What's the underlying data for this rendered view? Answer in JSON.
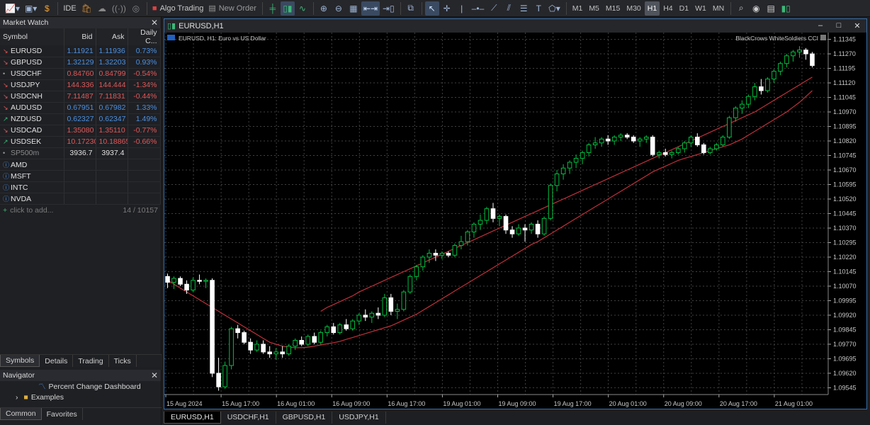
{
  "toolbar": {
    "algo_trading": "Algo Trading",
    "new_order": "New Order",
    "ide": "IDE",
    "timeframes": [
      "M1",
      "M5",
      "M15",
      "M30",
      "H1",
      "H4",
      "D1",
      "W1",
      "MN"
    ],
    "active_timeframe": "H1"
  },
  "market_watch": {
    "title": "Market Watch",
    "columns": [
      "Symbol",
      "Bid",
      "Ask",
      "Daily C..."
    ],
    "rows": [
      {
        "symbol": "EURUSD",
        "bid": "1.11921",
        "ask": "1.11936",
        "change": "0.73%",
        "trend": "dn",
        "color": "up"
      },
      {
        "symbol": "GBPUSD",
        "bid": "1.32129",
        "ask": "1.32203",
        "change": "0.93%",
        "trend": "dn",
        "color": "up"
      },
      {
        "symbol": "USDCHF",
        "bid": "0.84760",
        "ask": "0.84799",
        "change": "-0.54%",
        "trend": "gr",
        "color": "dn"
      },
      {
        "symbol": "USDJPY",
        "bid": "144.336",
        "ask": "144.444",
        "change": "-1.34%",
        "trend": "dn",
        "color": "dn"
      },
      {
        "symbol": "USDCNH",
        "bid": "7.11487",
        "ask": "7.11831",
        "change": "-0.44%",
        "trend": "dn",
        "color": "dn"
      },
      {
        "symbol": "AUDUSD",
        "bid": "0.67951",
        "ask": "0.67982",
        "change": "1.33%",
        "trend": "dn",
        "color": "up"
      },
      {
        "symbol": "NZDUSD",
        "bid": "0.62327",
        "ask": "0.62347",
        "change": "1.49%",
        "trend": "up",
        "color": "up"
      },
      {
        "symbol": "USDCAD",
        "bid": "1.35080",
        "ask": "1.35110",
        "change": "-0.77%",
        "trend": "dn",
        "color": "dn"
      },
      {
        "symbol": "USDSEK",
        "bid": "10.17230",
        "ask": "10.18865",
        "change": "-0.66%",
        "trend": "up",
        "color": "dn"
      },
      {
        "symbol": "SP500m",
        "bid": "3936.7",
        "ask": "3937.4",
        "change": "",
        "trend": "gr",
        "color": "wh"
      },
      {
        "symbol": "AMD",
        "bid": "",
        "ask": "",
        "change": "",
        "trend": "info",
        "color": "wh"
      },
      {
        "symbol": "MSFT",
        "bid": "",
        "ask": "",
        "change": "",
        "trend": "info",
        "color": "wh"
      },
      {
        "symbol": "INTC",
        "bid": "",
        "ask": "",
        "change": "",
        "trend": "info",
        "color": "wh"
      },
      {
        "symbol": "NVDA",
        "bid": "",
        "ask": "",
        "change": "",
        "trend": "info",
        "color": "wh"
      }
    ],
    "add_label": "click to add...",
    "count": "14 / 10157",
    "tabs": [
      "Symbols",
      "Details",
      "Trading",
      "Ticks"
    ],
    "active_tab": "Symbols"
  },
  "navigator": {
    "title": "Navigator",
    "items": [
      "Percent Change Dashboard",
      "Examples"
    ],
    "tabs": [
      "Common",
      "Favorites"
    ],
    "active_tab": "Common"
  },
  "chart_window": {
    "title": "EURUSD,H1",
    "info": "EURUSD, H1:  Euro vs US Dollar",
    "indicator": "BlackCrows WhiteSoldiers CCI"
  },
  "chart_data": {
    "type": "candlestick",
    "symbol": "EURUSD",
    "timeframe": "H1",
    "y_ticks": [
      1.11345,
      1.1127,
      1.11195,
      1.1112,
      1.11045,
      1.1097,
      1.10895,
      1.1082,
      1.10745,
      1.1067,
      1.10595,
      1.1052,
      1.10445,
      1.1037,
      1.10295,
      1.1022,
      1.10145,
      1.1007,
      1.09995,
      1.0992,
      1.09845,
      1.0977,
      1.09695,
      1.0962,
      1.09545
    ],
    "y_tick_labels": [
      "1.11345",
      "1.11270",
      "1.11195",
      "1.11120",
      "1.11045",
      "1.10970",
      "1.10895",
      "1.10820",
      "1.10745",
      "1.10670",
      "1.10595",
      "1.10520",
      "1.10445",
      "1.10370",
      "1.10295",
      "1.10220",
      "1.10145",
      "1.10070",
      "1.09995",
      "1.09920",
      "1.09845",
      "1.09770",
      "1.09695",
      "1.09620",
      "1.09545"
    ],
    "ylim": [
      1.0951,
      1.1138
    ],
    "x_labels": [
      "15 Aug 2024",
      "15 Aug 17:00",
      "16 Aug 01:00",
      "16 Aug 09:00",
      "16 Aug 17:00",
      "19 Aug 01:00",
      "19 Aug 09:00",
      "19 Aug 17:00",
      "20 Aug 01:00",
      "20 Aug 09:00",
      "20 Aug 17:00",
      "21 Aug 01:00"
    ],
    "grid": true,
    "candles": [
      [
        1.1012,
        1.10135,
        1.1006,
        1.1009
      ],
      [
        1.1009,
        1.1012,
        1.10055,
        1.1011
      ],
      [
        1.1011,
        1.1012,
        1.1007,
        1.1008
      ],
      [
        1.1008,
        1.101,
        1.1003,
        1.1005
      ],
      [
        1.1005,
        1.10115,
        1.1004,
        1.101
      ],
      [
        1.101,
        1.1013,
        1.1008,
        1.10095
      ],
      [
        1.10095,
        1.1011,
        1.1006,
        1.101
      ],
      [
        1.101,
        1.1011,
        1.096,
        1.0962
      ],
      [
        1.0962,
        1.097,
        1.0953,
        1.0955
      ],
      [
        1.0955,
        1.0968,
        1.0954,
        1.0966
      ],
      [
        1.0966,
        1.0986,
        1.0964,
        1.0985
      ],
      [
        1.0985,
        1.0987,
        1.098,
        1.0983
      ],
      [
        1.0983,
        1.0984,
        1.0977,
        1.0978
      ],
      [
        1.0978,
        1.098,
        1.0972,
        1.0974
      ],
      [
        1.0974,
        1.0979,
        1.0973,
        1.0977
      ],
      [
        1.0977,
        1.0979,
        1.0972,
        1.0973
      ],
      [
        1.0973,
        1.0976,
        1.097,
        1.0972
      ],
      [
        1.0972,
        1.0975,
        1.0969,
        1.0973
      ],
      [
        1.0973,
        1.0976,
        1.097,
        1.0972
      ],
      [
        1.0972,
        1.0977,
        1.0971,
        1.0976
      ],
      [
        1.0976,
        1.098,
        1.0974,
        1.0979
      ],
      [
        1.0979,
        1.0981,
        1.0976,
        1.0977
      ],
      [
        1.0977,
        1.0982,
        1.0976,
        1.0981
      ],
      [
        1.0981,
        1.0983,
        1.0977,
        1.0978
      ],
      [
        1.0978,
        1.0984,
        1.0977,
        1.0983
      ],
      [
        1.0983,
        1.0987,
        1.0981,
        1.0986
      ],
      [
        1.0986,
        1.0988,
        1.0982,
        1.0983
      ],
      [
        1.0983,
        1.0988,
        1.0982,
        1.0987
      ],
      [
        1.0987,
        1.099,
        1.0984,
        1.0985
      ],
      [
        1.0985,
        1.099,
        1.0984,
        1.0989
      ],
      [
        1.0989,
        1.0993,
        1.0987,
        1.0992
      ],
      [
        1.0992,
        1.0995,
        1.0989,
        1.0991
      ],
      [
        1.0991,
        1.0994,
        1.0988,
        1.0993
      ],
      [
        1.0993,
        1.0996,
        1.099,
        1.0992
      ],
      [
        1.0992,
        1.1003,
        1.0991,
        1.1001
      ],
      [
        1.1001,
        1.1003,
        1.0992,
        1.0994
      ],
      [
        1.0994,
        1.0998,
        1.099,
        1.0995
      ],
      [
        1.0995,
        1.1005,
        1.0994,
        1.1004
      ],
      [
        1.1004,
        1.1013,
        1.1003,
        1.1012
      ],
      [
        1.1012,
        1.1018,
        1.101,
        1.1017
      ],
      [
        1.1017,
        1.1023,
        1.1015,
        1.1022
      ],
      [
        1.1022,
        1.1026,
        1.1019,
        1.1024
      ],
      [
        1.1024,
        1.1026,
        1.102,
        1.1023
      ],
      [
        1.1023,
        1.1025,
        1.1021,
        1.1024
      ],
      [
        1.1024,
        1.1025,
        1.1022,
        1.1023
      ],
      [
        1.1023,
        1.1029,
        1.1022,
        1.1028
      ],
      [
        1.1028,
        1.1033,
        1.1026,
        1.103
      ],
      [
        1.103,
        1.1036,
        1.1028,
        1.1035
      ],
      [
        1.1035,
        1.104,
        1.1032,
        1.1039
      ],
      [
        1.1039,
        1.1044,
        1.1036,
        1.1041
      ],
      [
        1.1041,
        1.1048,
        1.1039,
        1.1047
      ],
      [
        1.1047,
        1.105,
        1.104,
        1.1042
      ],
      [
        1.1042,
        1.1044,
        1.1038,
        1.1043
      ],
      [
        1.1043,
        1.1044,
        1.1034,
        1.1036
      ],
      [
        1.1036,
        1.1038,
        1.1032,
        1.1034
      ],
      [
        1.1034,
        1.1039,
        1.1033,
        1.1037
      ],
      [
        1.1037,
        1.1039,
        1.103,
        1.1036
      ],
      [
        1.1036,
        1.104,
        1.1034,
        1.1039
      ],
      [
        1.1039,
        1.1041,
        1.1032,
        1.1034
      ],
      [
        1.1034,
        1.1043,
        1.1033,
        1.1042
      ],
      [
        1.1042,
        1.106,
        1.1041,
        1.1059
      ],
      [
        1.1059,
        1.1067,
        1.1056,
        1.1065
      ],
      [
        1.1065,
        1.107,
        1.1062,
        1.1068
      ],
      [
        1.1068,
        1.1072,
        1.1065,
        1.1071
      ],
      [
        1.1071,
        1.1075,
        1.1068,
        1.1073
      ],
      [
        1.1073,
        1.1077,
        1.107,
        1.1076
      ],
      [
        1.1076,
        1.1081,
        1.1074,
        1.108
      ],
      [
        1.108,
        1.1084,
        1.1078,
        1.1081
      ],
      [
        1.1081,
        1.1084,
        1.1079,
        1.1083
      ],
      [
        1.1083,
        1.1085,
        1.108,
        1.1082
      ],
      [
        1.1082,
        1.1085,
        1.108,
        1.1084
      ],
      [
        1.1084,
        1.1086,
        1.1082,
        1.1085
      ],
      [
        1.1085,
        1.1086,
        1.1083,
        1.1084
      ],
      [
        1.1084,
        1.1085,
        1.1081,
        1.1082
      ],
      [
        1.1082,
        1.1084,
        1.1079,
        1.1083
      ],
      [
        1.1083,
        1.1085,
        1.1081,
        1.1084
      ],
      [
        1.1084,
        1.1085,
        1.1074,
        1.1075
      ],
      [
        1.1075,
        1.1077,
        1.1073,
        1.1076
      ],
      [
        1.1076,
        1.1078,
        1.1074,
        1.1075
      ],
      [
        1.1075,
        1.1077,
        1.1073,
        1.1076
      ],
      [
        1.1076,
        1.1079,
        1.1075,
        1.1078
      ],
      [
        1.1078,
        1.1082,
        1.1076,
        1.1081
      ],
      [
        1.1081,
        1.1085,
        1.1079,
        1.1084
      ],
      [
        1.1084,
        1.1086,
        1.1079,
        1.108
      ],
      [
        1.108,
        1.1081,
        1.1075,
        1.1076
      ],
      [
        1.1076,
        1.1079,
        1.1075,
        1.1078
      ],
      [
        1.1078,
        1.1081,
        1.1077,
        1.108
      ],
      [
        1.108,
        1.1085,
        1.1079,
        1.1084
      ],
      [
        1.1084,
        1.1095,
        1.1083,
        1.1094
      ],
      [
        1.1094,
        1.11,
        1.1092,
        1.1099
      ],
      [
        1.1099,
        1.1103,
        1.1096,
        1.1101
      ],
      [
        1.1101,
        1.1106,
        1.1099,
        1.1105
      ],
      [
        1.1105,
        1.1112,
        1.1103,
        1.111
      ],
      [
        1.111,
        1.1114,
        1.1106,
        1.1108
      ],
      [
        1.1108,
        1.1115,
        1.1107,
        1.1114
      ],
      [
        1.1114,
        1.1119,
        1.1112,
        1.1118
      ],
      [
        1.1118,
        1.1123,
        1.1116,
        1.1122
      ],
      [
        1.1122,
        1.1127,
        1.112,
        1.1126
      ],
      [
        1.1126,
        1.1129,
        1.1123,
        1.1128
      ],
      [
        1.1128,
        1.1131,
        1.1125,
        1.1129
      ],
      [
        1.1129,
        1.113,
        1.1124,
        1.1127
      ],
      [
        1.1127,
        1.1128,
        1.112,
        1.1121
      ]
    ],
    "upper_band": [
      null,
      null,
      null,
      null,
      null,
      null,
      null,
      null,
      null,
      null,
      null,
      null,
      null,
      null,
      null,
      null,
      null,
      null,
      null,
      null,
      null,
      null,
      null,
      null,
      1.0994,
      1.0996,
      1.09975,
      1.0999,
      1.10005,
      1.1002,
      1.1004,
      1.10055,
      1.1007,
      1.10085,
      1.101,
      1.10115,
      1.1013,
      1.10145,
      1.1016,
      1.10175,
      1.1019,
      1.10205,
      1.1022,
      1.10235,
      1.1025,
      1.10265,
      1.1028,
      1.10295,
      1.1031,
      1.10325,
      1.1034,
      1.10355,
      1.1037,
      1.10385,
      1.104,
      1.10415,
      1.1043,
      1.10445,
      1.1046,
      1.10475,
      1.1049,
      1.10505,
      1.1052,
      1.10535,
      1.1055,
      1.10565,
      1.1058,
      1.10595,
      1.1061,
      1.10625,
      1.1064,
      1.10655,
      1.1067,
      1.10685,
      1.107,
      1.10715,
      1.1073,
      1.10745,
      1.1076,
      1.10775,
      1.1079,
      1.10805,
      1.1082,
      1.10835,
      1.1085,
      1.10865,
      1.1088,
      1.10895,
      1.1091,
      1.10925,
      1.1094,
      1.10955,
      1.1097,
      1.1099,
      1.1101,
      1.1103,
      1.1105,
      1.1107,
      1.1109,
      1.1111,
      1.1113,
      1.1115
    ],
    "lower_band": [
      1.101,
      1.1008,
      1.1006,
      1.1004,
      1.1002,
      1.1,
      1.0998,
      1.0996,
      1.0994,
      1.0992,
      1.099,
      1.0988,
      1.0986,
      1.0984,
      1.0982,
      1.098,
      1.0978,
      1.0977,
      1.0976,
      1.09755,
      1.09752,
      1.09752,
      1.09755,
      1.0976,
      1.09766,
      1.09772,
      1.09778,
      1.09785,
      1.09795,
      1.09805,
      1.09815,
      1.09825,
      1.09835,
      1.09845,
      1.09855,
      1.09865,
      1.0988,
      1.09895,
      1.0991,
      1.09925,
      1.09945,
      1.09965,
      1.09985,
      1.10005,
      1.10025,
      1.10045,
      1.10065,
      1.10085,
      1.10105,
      1.10125,
      1.10145,
      1.10165,
      1.10185,
      1.10205,
      1.10225,
      1.10245,
      1.10265,
      1.10285,
      1.103,
      1.1032,
      1.1034,
      1.1036,
      1.1038,
      1.104,
      1.1042,
      1.1044,
      1.1046,
      1.1048,
      1.105,
      1.1052,
      1.1054,
      1.1056,
      1.1058,
      1.106,
      1.1062,
      1.1064,
      1.1066,
      1.10675,
      1.1069,
      1.10705,
      1.1072,
      1.1073,
      1.1074,
      1.1075,
      1.1076,
      1.1077,
      1.1078,
      1.1079,
      1.108,
      1.10815,
      1.1083,
      1.1085,
      1.1087,
      1.1089,
      1.1091,
      1.1093,
      1.1095,
      1.1097,
      1.10995,
      1.1102,
      1.1105,
      1.1108
    ]
  },
  "bottom_tabs": [
    "EURUSD,H1",
    "USDCHF,H1",
    "GBPUSD,H1",
    "USDJPY,H1"
  ],
  "bottom_active": "EURUSD,H1",
  "colors": {
    "bull": "#00c040",
    "bear": "#ffffff",
    "band": "#c0303a",
    "grid": "#404040",
    "accent": "#3a6ea5"
  }
}
